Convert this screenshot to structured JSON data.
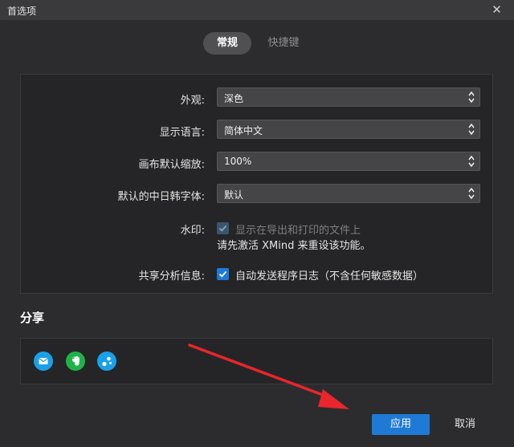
{
  "window": {
    "title": "首选项",
    "close_glyph": "✕"
  },
  "tabs": [
    {
      "label": "常规",
      "active": true
    },
    {
      "label": "快捷键",
      "active": false
    }
  ],
  "settings": {
    "appearance": {
      "label": "外观:",
      "value": "深色"
    },
    "language": {
      "label": "显示语言:",
      "value": "简体中文"
    },
    "zoom": {
      "label": "画布默认缩放:",
      "value": "100%"
    },
    "cjk_font": {
      "label": "默认的中日韩字体:",
      "value": "默认"
    },
    "watermark": {
      "label": "水印:",
      "checkbox_label": "显示在导出和打印的文件上",
      "checked": true,
      "disabled": true,
      "note": "请先激活 XMind 来重设该功能。"
    },
    "analytics": {
      "label": "共享分析信息:",
      "checkbox_label": "自动发送程序日志（不含任何敏感数据）",
      "checked": true
    }
  },
  "share": {
    "title": "分享",
    "icons": [
      {
        "name": "mail-icon",
        "color": "#1aa0e8"
      },
      {
        "name": "evernote-icon",
        "color": "#1fb34a"
      },
      {
        "name": "share-service-icon",
        "color": "#1aa0e8"
      }
    ]
  },
  "buttons": {
    "apply": "应用",
    "cancel": "取消"
  },
  "colors": {
    "accent": "#1f7ad6",
    "background": "#2c2c2e",
    "titlebar": "#3a3a3c",
    "arrow": "#e8262b"
  }
}
